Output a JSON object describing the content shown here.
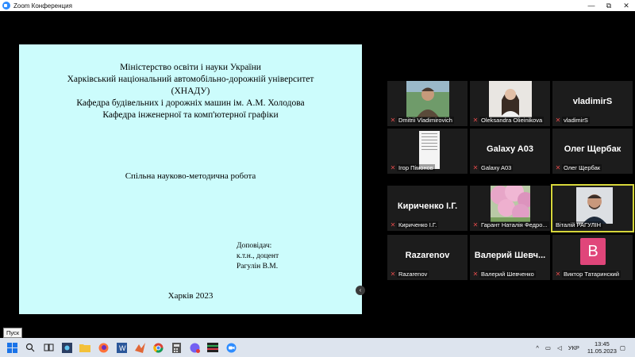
{
  "window": {
    "title": "Zoom Конференция",
    "controls": [
      "—",
      "⧉",
      "✕"
    ]
  },
  "slide": {
    "header_lines": [
      "Міністерство освіти і науки України",
      "Харківський національний автомобільно-дорожній університет",
      "(ХНАДУ)",
      "Кафедра будівельних і дорожніх машин ім. А.М. Холодова",
      "Кафедра інженерної та комп'ютерної графіки"
    ],
    "subtitle": "Спільна науково-методична робота",
    "speaker_lines": [
      "Доповідач:",
      "к.т.н., доцент",
      "Рагулін В.М."
    ],
    "city_year": "Харків 2023"
  },
  "participants": [
    {
      "name": "Dmitrii Vladimirovich",
      "display": "",
      "type": "photo",
      "muted": true
    },
    {
      "name": "Oleksandra Olieinikova",
      "display": "",
      "type": "photo",
      "muted": true
    },
    {
      "name": "vladimirS",
      "display": "vladimirS",
      "type": "text",
      "muted": true
    },
    {
      "name": "Ігор Пімонов",
      "display": "",
      "type": "document",
      "muted": true
    },
    {
      "name": "Galaxy A03",
      "display": "Galaxy A03",
      "type": "text",
      "muted": true
    },
    {
      "name": "Олег Щербак",
      "display": "Олег Щербак",
      "type": "text",
      "muted": true
    },
    {
      "name": "Кириченко І.Г.",
      "display": "Кириченко І.Г.",
      "type": "text",
      "muted": true
    },
    {
      "name": "Гарант Наталія Федро...",
      "display": "",
      "type": "blossom",
      "muted": true
    },
    {
      "name": "Віталій РАГУЛІН",
      "display": "",
      "type": "photo",
      "muted": false,
      "active": true
    },
    {
      "name": "Razarenov",
      "display": "Razarenov",
      "type": "text",
      "muted": true
    },
    {
      "name": "Валерий Шевченко",
      "display": "Валерий Шевч...",
      "type": "text",
      "muted": true
    },
    {
      "name": "Виктор Татаринский",
      "display": "B",
      "type": "avatar",
      "muted": true
    }
  ],
  "tooltip": "Пуск",
  "taskbar": {
    "apps": [
      "start-icon",
      "search-icon",
      "task-view-icon",
      "app-window-icon",
      "file-explorer-icon",
      "firefox-icon",
      "word-icon",
      "matlab-icon",
      "chrome-icon",
      "calculator-icon",
      "viber-icon",
      "media-icon",
      "zoom-icon"
    ],
    "tray": {
      "language": "УКР",
      "time": "13:45",
      "date": "11.05.2023"
    }
  },
  "colors": {
    "slide_bg": "#ccfcfc",
    "active_border": "#d6d63a",
    "muted_red": "#e04a4a",
    "avatar_pink": "#e0467a",
    "zoom_blue": "#2d8cff"
  }
}
